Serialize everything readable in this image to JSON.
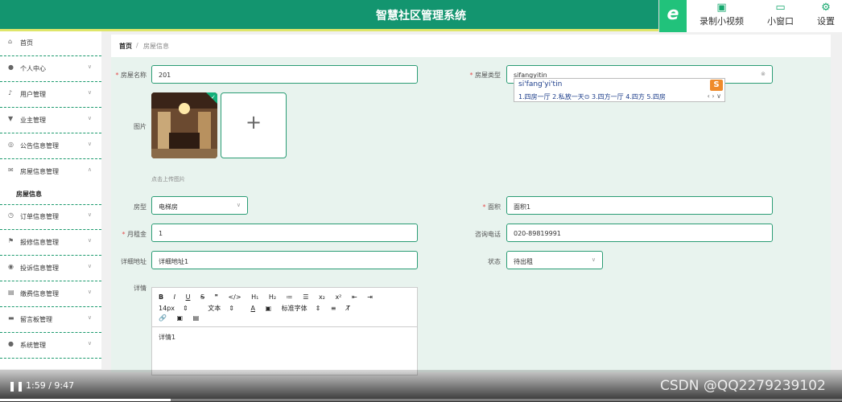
{
  "app": {
    "title": "智慧社区管理系统"
  },
  "recorder": {
    "logo": "e",
    "buttons": [
      {
        "icon": "video-camera-icon",
        "label": "录制小视频"
      },
      {
        "icon": "tv-icon",
        "label": "小窗口"
      },
      {
        "icon": "gear-icon",
        "label": "设置"
      }
    ]
  },
  "sidebar": {
    "items": [
      {
        "icon": "home-icon",
        "label": "首页"
      },
      {
        "icon": "user-icon",
        "label": "个人中心"
      },
      {
        "icon": "mic-icon",
        "label": "用户管理"
      },
      {
        "icon": "owner-icon",
        "label": "业主管理"
      },
      {
        "icon": "notice-icon",
        "label": "公告信息管理"
      },
      {
        "icon": "mail-icon",
        "label": "房屋信息管理"
      },
      {
        "icon": "order-icon",
        "label": "订单信息管理"
      },
      {
        "icon": "flag-icon",
        "label": "报修信息管理"
      },
      {
        "icon": "location-icon",
        "label": "投诉信息管理"
      },
      {
        "icon": "wallet-icon",
        "label": "缴费信息管理"
      },
      {
        "icon": "message-icon",
        "label": "留言板管理"
      },
      {
        "icon": "settings-icon",
        "label": "系统管理"
      }
    ],
    "active_sub": "房屋信息"
  },
  "breadcrumb": {
    "home": "首页",
    "sep": "/",
    "current": "房屋信息"
  },
  "form": {
    "name_label": "房屋名称",
    "name_value": "201",
    "type_label": "房屋类型",
    "type_value": "sifangyitin",
    "image_label": "图片",
    "upload_hint": "点击上传图片",
    "house_type_label": "房型",
    "house_type_value": "电梯房",
    "area_label": "面积",
    "area_value": "面积1",
    "rent_label": "月租金",
    "rent_value": "1",
    "phone_label": "咨询电话",
    "phone_value": "020-89819991",
    "address_label": "详细地址",
    "address_value": "详细地址1",
    "status_label": "状态",
    "status_value": "待出租",
    "detail_label": "详情",
    "detail_value": "详情1"
  },
  "ime": {
    "pinyin": "si'fang'yi'tin",
    "candidates": "1.四房一厅  2.私放一天⊙  3.四方一厅  4.四方  5.四房",
    "logo": "S"
  },
  "editor": {
    "toolbar_row1": [
      "B",
      "I",
      "U",
      "S",
      "❞",
      "</>",
      "H₁",
      "H₂",
      "≔",
      "☰",
      "x₂",
      "x²",
      "⇤",
      "⇥"
    ],
    "font_size": "14px",
    "text_style": "文本",
    "font_family": "标准字体"
  },
  "video": {
    "time": "1:59 / 9:47",
    "progress": 0.203
  },
  "watermark": "CSDN @QQ2279239102"
}
